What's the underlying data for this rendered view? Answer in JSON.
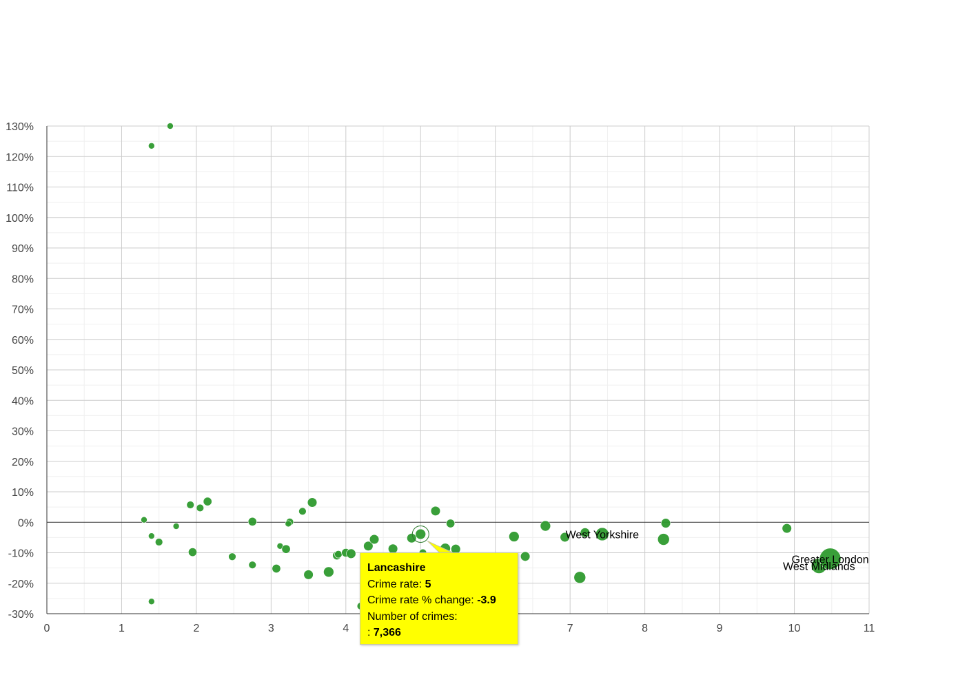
{
  "chart_data": {
    "type": "scatter",
    "title": "",
    "xlabel": "",
    "ylabel": "",
    "xlim": [
      0,
      11
    ],
    "ylim": [
      -30,
      130
    ],
    "x_ticks": [
      "0",
      "1",
      "2",
      "3",
      "4",
      "5",
      "6",
      "7",
      "8",
      "9",
      "10",
      "11"
    ],
    "y_ticks": [
      "-30%",
      "-20%",
      "-10%",
      "0%",
      "10%",
      "20%",
      "30%",
      "40%",
      "50%",
      "60%",
      "70%",
      "80%",
      "90%",
      "100%",
      "110%",
      "120%",
      "130%"
    ],
    "grid": true,
    "bubble_color": "#2e9a2e",
    "points": [
      {
        "x": 1.65,
        "y": 130,
        "s": 1
      },
      {
        "x": 1.4,
        "y": 123.5,
        "s": 1
      },
      {
        "x": 1.3,
        "y": 0.8,
        "s": 1
      },
      {
        "x": 1.4,
        "y": -4.5,
        "s": 1
      },
      {
        "x": 1.5,
        "y": -6.5,
        "s": 1.5
      },
      {
        "x": 1.73,
        "y": -1.3,
        "s": 1
      },
      {
        "x": 1.4,
        "y": -26,
        "s": 1
      },
      {
        "x": 1.92,
        "y": 5.7,
        "s": 1.5
      },
      {
        "x": 1.95,
        "y": -9.8,
        "s": 2
      },
      {
        "x": 2.05,
        "y": 4.7,
        "s": 1.5
      },
      {
        "x": 2.15,
        "y": 6.8,
        "s": 2
      },
      {
        "x": 2.48,
        "y": -11.3,
        "s": 1.5
      },
      {
        "x": 2.75,
        "y": 0.2,
        "s": 2
      },
      {
        "x": 2.75,
        "y": -14,
        "s": 1.5
      },
      {
        "x": 3.07,
        "y": -15.2,
        "s": 2
      },
      {
        "x": 3.12,
        "y": -7.8,
        "s": 1
      },
      {
        "x": 3.2,
        "y": -8.8,
        "s": 2
      },
      {
        "x": 3.25,
        "y": 0.1,
        "s": 1.5
      },
      {
        "x": 3.23,
        "y": -0.5,
        "s": 1
      },
      {
        "x": 3.42,
        "y": 3.6,
        "s": 1.5
      },
      {
        "x": 3.55,
        "y": 6.5,
        "s": 2.5
      },
      {
        "x": 3.5,
        "y": -17.2,
        "s": 2.5
      },
      {
        "x": 3.77,
        "y": -16.3,
        "s": 3
      },
      {
        "x": 3.88,
        "y": -10.9,
        "s": 2
      },
      {
        "x": 3.9,
        "y": -10.5,
        "s": 1.5
      },
      {
        "x": 4.0,
        "y": -10,
        "s": 2
      },
      {
        "x": 4.07,
        "y": -10.3,
        "s": 2.5
      },
      {
        "x": 4.3,
        "y": -7.8,
        "s": 2.5
      },
      {
        "x": 4.38,
        "y": -5.6,
        "s": 2.5
      },
      {
        "x": 4.2,
        "y": -27.5,
        "s": 1.5
      },
      {
        "x": 4.63,
        "y": -8.7,
        "s": 2.5
      },
      {
        "x": 4.88,
        "y": -5.2,
        "s": 2.5
      },
      {
        "x": 5.0,
        "y": -3.9,
        "s": 3
      },
      {
        "x": 5.03,
        "y": -10,
        "s": 1.5
      },
      {
        "x": 5.2,
        "y": 3.7,
        "s": 2.5
      },
      {
        "x": 5.33,
        "y": -8.6,
        "s": 3
      },
      {
        "x": 5.4,
        "y": -0.4,
        "s": 2
      },
      {
        "x": 5.47,
        "y": -8.8,
        "s": 2.5
      },
      {
        "x": 6.25,
        "y": -4.7,
        "s": 3
      },
      {
        "x": 6.4,
        "y": -11.2,
        "s": 2.5
      },
      {
        "x": 6.67,
        "y": -1.2,
        "s": 3
      },
      {
        "x": 6.93,
        "y": -4.9,
        "s": 2.5
      },
      {
        "x": 7.13,
        "y": -18.1,
        "s": 4
      },
      {
        "x": 7.2,
        "y": -3.4,
        "s": 2.5
      },
      {
        "x": 7.43,
        "y": -3.9,
        "s": 5
      },
      {
        "x": 8.25,
        "y": -5.6,
        "s": 4
      },
      {
        "x": 8.28,
        "y": -0.3,
        "s": 2.5
      },
      {
        "x": 9.9,
        "y": -2,
        "s": 2.5
      },
      {
        "x": 10.33,
        "y": -14.3,
        "s": 7
      },
      {
        "x": 10.48,
        "y": -12,
        "s": 14
      }
    ],
    "labels": [
      {
        "text": "West Yorkshire",
        "x": 7.43,
        "y": -3.9
      },
      {
        "text": "Greater London",
        "x": 10.48,
        "y": -12
      },
      {
        "text": "West Midlands",
        "x": 10.33,
        "y": -14.3
      }
    ],
    "tooltip": {
      "title": "Lancashire",
      "crime_rate_label": "Crime rate:",
      "crime_rate_value": "5",
      "change_label": "Crime rate % change:",
      "change_value": "-3.9",
      "count_label": "Number of crimes:",
      "count_prefix": ":",
      "count_value": "7,366",
      "x": 5.0,
      "y": -3.9
    }
  }
}
